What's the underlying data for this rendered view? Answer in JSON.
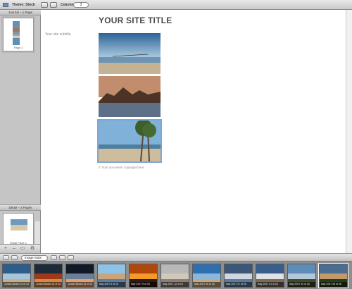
{
  "toolbar": {
    "theme_label": "Theme: Stock",
    "columns_label": "Columns:",
    "columns_value": "3"
  },
  "sidebar": {
    "journal_header": "Journal – 1 Page",
    "journal_page_label": "Page 1",
    "detail_header": "Detail – 3 Pages",
    "detail_page_label": "Detail Page 1"
  },
  "main": {
    "site_title": "YOUR SITE TITLE",
    "site_subtitle": "Your site subtitle",
    "copyright": "© Your document copyright here",
    "photos": [
      {
        "name": "beach-photo"
      },
      {
        "name": "mountain-photo"
      },
      {
        "name": "palm-photo",
        "selected": true
      }
    ]
  },
  "browser": {
    "view_select": "Image Stats"
  },
  "filmstrip": {
    "items": [
      {
        "label": "Jordan Beach 19 of 22",
        "colors": [
          "#2d5d8a",
          "#a7c4d8",
          "#c1b08a"
        ]
      },
      {
        "label": "Jordan Beach 21 of 22",
        "colors": [
          "#1c2a3a",
          "#9e3a1a",
          "#d88840"
        ]
      },
      {
        "label": "Jordan Beach 22 of 22",
        "colors": [
          "#0f1a26",
          "#6a7e96",
          "#e0a070"
        ]
      },
      {
        "label": "Italy 2007 5 of 15",
        "colors": [
          "#8ec2e6",
          "#caa57a",
          "#5b7fa3"
        ]
      },
      {
        "label": "Italy 2007 9 of 15",
        "colors": [
          "#b2470c",
          "#f39a28",
          "#2d1a10"
        ]
      },
      {
        "label": "Italy 2007 12 of 15",
        "colors": [
          "#b8b8b8",
          "#d0c8b8",
          "#8a7f72"
        ]
      },
      {
        "label": "Italy 2007 26 of 26",
        "colors": [
          "#2e6fb0",
          "#8ab7da",
          "#c4a882"
        ]
      },
      {
        "label": "Italy 2007 27 of 26",
        "colors": [
          "#3a5678",
          "#d0d6dd",
          "#5d7a9c"
        ]
      },
      {
        "label": "Italy 2007 31 of 26",
        "colors": [
          "#385f8c",
          "#e0e2e4",
          "#7b6a5c"
        ]
      },
      {
        "label": "Italy 2007 32 of 26",
        "colors": [
          "#5d8cb8",
          "#b3c7d8",
          "#3f4b2d"
        ]
      },
      {
        "label": "Italy 2007 35 of 26",
        "colors": [
          "#4b6d8f",
          "#c09a6a",
          "#2a3a1c"
        ]
      }
    ]
  }
}
